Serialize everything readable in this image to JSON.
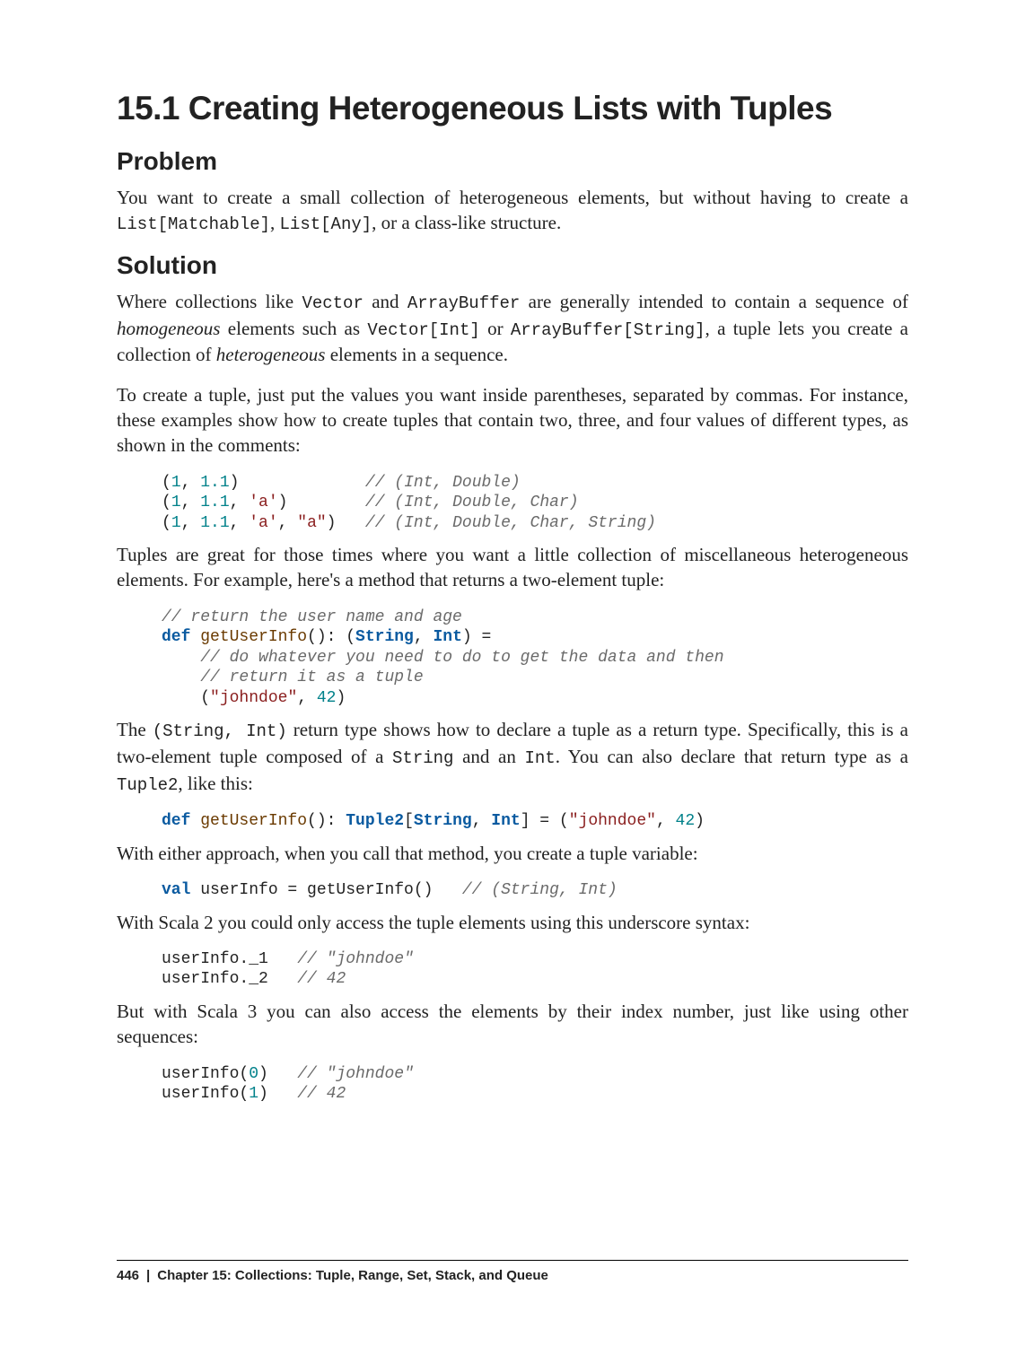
{
  "title": "15.1 Creating Heterogeneous Lists with Tuples",
  "sections": {
    "problem": {
      "heading": "Problem",
      "p1_a": "You want to create a small collection of heterogeneous elements, but without having to create a ",
      "p1_code1": "List[Matchable]",
      "p1_mid": ", ",
      "p1_code2": "List[Any]",
      "p1_b": ", or a class-like structure."
    },
    "solution": {
      "heading": "Solution",
      "p1_a": "Where collections like ",
      "p1_code1": "Vector",
      "p1_b": " and ",
      "p1_code2": "ArrayBuffer",
      "p1_c": " are generally intended to contain a sequence of ",
      "p1_em1": "homogeneous",
      "p1_d": " elements such as ",
      "p1_code3": "Vector[Int]",
      "p1_e": " or ",
      "p1_code4": "ArrayBuffer[String]",
      "p1_f": ", a tuple lets you create a collection of ",
      "p1_em2": "heterogeneous",
      "p1_g": " elements in a sequence.",
      "p2": "To create a tuple, just put the values you want inside parentheses, separated by commas. For instance, these examples show how to create tuples that contain two, three, and four values of different types, as shown in the comments:",
      "code1": {
        "l1_open": "(",
        "l1_n1": "1",
        "l1_c": ", ",
        "l1_n2": "1.1",
        "l1_close": ")",
        "l1_pad": "             ",
        "l1_cmt": "// (Int, Double)",
        "l2_open": "(",
        "l2_n1": "1",
        "l2_c1": ", ",
        "l2_n2": "1.1",
        "l2_c2": ", ",
        "l2_s1": "'a'",
        "l2_close": ")",
        "l2_pad": "        ",
        "l2_cmt": "// (Int, Double, Char)",
        "l3_open": "(",
        "l3_n1": "1",
        "l3_c1": ", ",
        "l3_n2": "1.1",
        "l3_c2": ", ",
        "l3_s1": "'a'",
        "l3_c3": ", ",
        "l3_s2": "\"a\"",
        "l3_close": ")",
        "l3_pad": "   ",
        "l3_cmt": "// (Int, Double, Char, String)"
      },
      "p3": "Tuples are great for those times where you want a little collection of miscellaneous heterogeneous elements. For example, here's a method that returns a two-element tuple:",
      "code2": {
        "l1": "// return the user name and age",
        "l2_def": "def",
        "l2_fn": " getUserInfo",
        "l2_sig1": "()",
        "l2_colon": ": (",
        "l2_t1": "String",
        "l2_comma": ", ",
        "l2_t2": "Int",
        "l2_end": ") =",
        "l3_ind": "    ",
        "l3": "// do whatever you need to do to get the data and then",
        "l4_ind": "    ",
        "l4": "// return it as a tuple",
        "l5_ind": "    ",
        "l5_open": "(",
        "l5_s": "\"johndoe\"",
        "l5_c": ", ",
        "l5_n": "42",
        "l5_close": ")"
      },
      "p4_a": "The ",
      "p4_code1": "(String, Int)",
      "p4_b": " return type shows how to declare a tuple as a return type. Specifically, this is a two-element tuple composed of a ",
      "p4_code2": "String",
      "p4_c": " and an ",
      "p4_code3": "Int",
      "p4_d": ". You can also declare that return type as a ",
      "p4_code4": "Tuple2",
      "p4_e": ", like this:",
      "code3": {
        "def": "def",
        "fn": " getUserInfo",
        "sig": "()",
        "colon": ": ",
        "t0": "Tuple2",
        "br1": "[",
        "t1": "String",
        "comma": ", ",
        "t2": "Int",
        "br2": "] = (",
        "s": "\"johndoe\"",
        "c2": ", ",
        "n": "42",
        "close": ")"
      },
      "p5": "With either approach, when you call that method, you create a tuple variable:",
      "code4": {
        "val": "val",
        "rest": " userInfo = getUserInfo()   ",
        "cmt": "// (String, Int)"
      },
      "p6": "With Scala 2 you could only access the tuple elements using this underscore syntax:",
      "code5": {
        "l1": "userInfo._1   ",
        "l1_cmt": "// \"johndoe\"",
        "l2": "userInfo._2   ",
        "l2_cmt": "// 42"
      },
      "p7": "But with Scala 3 you can also access the elements by their index number, just like using other sequences:",
      "code6": {
        "l1_a": "userInfo(",
        "l1_n": "0",
        "l1_b": ")   ",
        "l1_cmt": "// \"johndoe\"",
        "l2_a": "userInfo(",
        "l2_n": "1",
        "l2_b": ")   ",
        "l2_cmt": "// 42"
      }
    }
  },
  "footer": {
    "page": "446",
    "chapter": "Chapter 15: Collections: Tuple, Range, Set, Stack, and Queue"
  }
}
